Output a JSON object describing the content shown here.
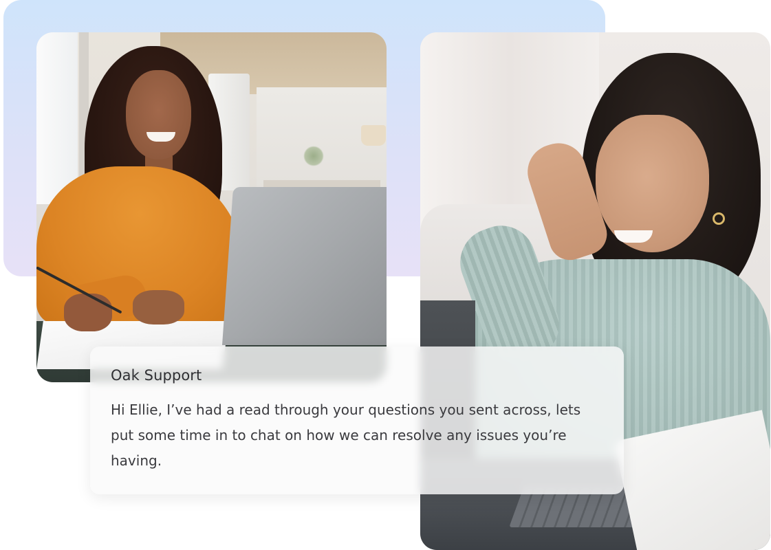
{
  "chat": {
    "sender": "Oak Support",
    "message": "Hi Ellie, I’ve had a read through your questions you sent across, lets put some time in to chat on how we can resolve any issues you’re having."
  },
  "colors": {
    "gradient_top": "#cfe4fb",
    "gradient_bottom": "#e7e1f7",
    "card_background": "#fafafa",
    "text_primary": "#2f2f33"
  }
}
